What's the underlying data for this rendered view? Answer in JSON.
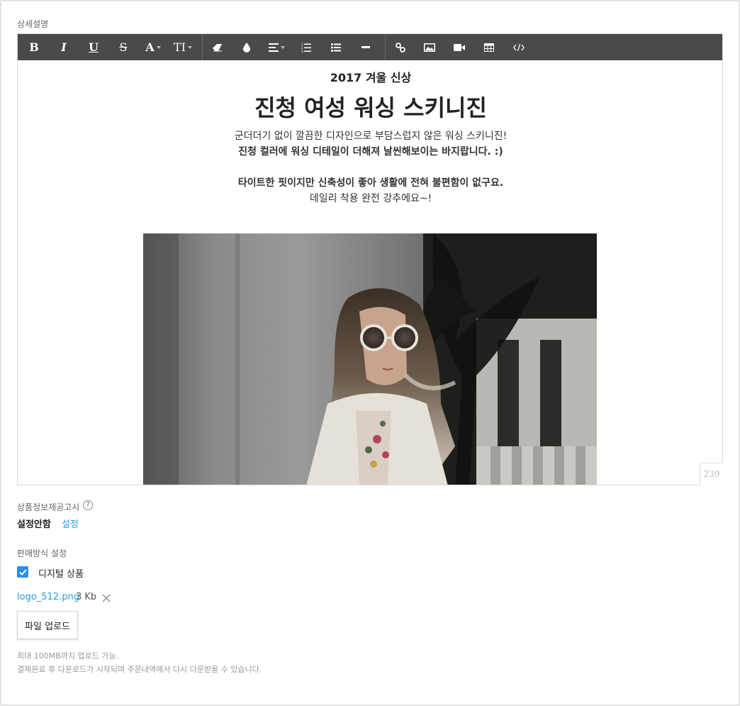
{
  "detail": {
    "section_label": "상세설명",
    "toolbar": {
      "bold": "B",
      "italic": "I",
      "underline": "U",
      "strike": "S",
      "font_color": "A",
      "font_size": "TI",
      "icons": [
        "bold-icon",
        "italic-icon",
        "underline-icon",
        "strikethrough-icon",
        "font-color-icon",
        "font-size-icon",
        "eraser-icon",
        "drop-icon",
        "align-icon",
        "ordered-list-icon",
        "unordered-list-icon",
        "horizontal-rule-icon",
        "link-icon",
        "image-icon",
        "video-icon",
        "table-icon",
        "code-icon"
      ]
    },
    "content": {
      "subtitle": "2017 겨울 신상",
      "title": "진청 여성 워싱 스키니진",
      "line1": "군더더기 없이 깔끔한 디자인으로 부담스럽지 않은 워싱 스키니진!",
      "line2": "진청 컬러에 워싱 디테일이 더해져 날씬해보이는 바지랍니다. :)",
      "line3": "타이트한 핏이지만 신축성이 좋아 생활에 전혀 불편함이 없구요.",
      "line4": "데일리 착용 완전 강추에요~!"
    },
    "char_count": "239"
  },
  "notice": {
    "label": "상품정보제공고시",
    "help_glyph": "?",
    "status": "설정안함",
    "set_link": "설정"
  },
  "sales": {
    "label": "판매방식 설정",
    "digital_label": "디지털 상품",
    "digital_checked": true,
    "file_name": "logo_512.png",
    "file_size": "3 Kb",
    "upload_button": "파일 업로드",
    "note1": "최대 100MB까지 업로드 가능.",
    "note2": "결제완료 후 다운로드가 시작되며 주문내역에서 다시 다운받을 수 있습니다."
  },
  "colors": {
    "accent": "#27a0e0",
    "checkbox": "#2b8ff0",
    "toolbar": "#4a4a4a"
  }
}
